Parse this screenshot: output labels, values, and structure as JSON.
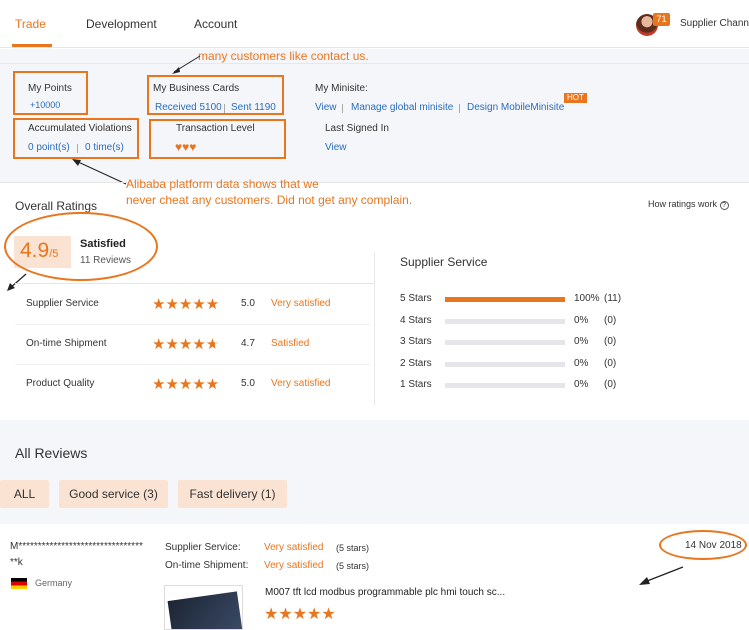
{
  "nav": {
    "tabs": [
      "Trade",
      "Development",
      "Account"
    ],
    "badge": "71",
    "channel": "Supplier Channe"
  },
  "annotations": {
    "contact": "many customers like contact us.",
    "cheat_line1": "Alibaba platform data shows that we",
    "cheat_line2": "never cheat any customers. Did not get any complain."
  },
  "account": {
    "points_label": "My Points",
    "points_value": "+10000",
    "cards_label": "My Business Cards",
    "cards_received": "Received 5100",
    "cards_sent": "Sent 1190",
    "minisite_label": "My Minisite:",
    "minisite_links": [
      "View",
      "Manage global minisite",
      "Design MobileMinisite"
    ],
    "hot_badge": "HOT",
    "violations_label": "Accumulated Violations",
    "violations_points": "0 point(s)",
    "violations_times": "0 time(s)",
    "transaction_label": "Transaction Level",
    "transaction_level": 3,
    "last_signed_label": "Last Signed In",
    "last_signed_link": "View"
  },
  "ratings": {
    "title": "Overall Ratings",
    "how_link": "How ratings work",
    "score": "4.9",
    "score_max": "/5",
    "summary": "Satisfied",
    "reviews": "11 Reviews",
    "categories": [
      {
        "name": "Supplier Service",
        "stars": 5.0,
        "score": "5.0",
        "verdict": "Very satisfied"
      },
      {
        "name": "On-time Shipment",
        "stars": 4.7,
        "score": "4.7",
        "verdict": "Satisfied"
      },
      {
        "name": "Product Quality",
        "stars": 5.0,
        "score": "5.0",
        "verdict": "Very satisfied"
      }
    ],
    "breakdown_title": "Supplier Service",
    "breakdown": [
      {
        "label": "5 Stars",
        "fraction": 1.0,
        "pct": "100%",
        "count": "(11)"
      },
      {
        "label": "4 Stars",
        "fraction": 0,
        "pct": "0%",
        "count": "(0)"
      },
      {
        "label": "3 Stars",
        "fraction": 0,
        "pct": "0%",
        "count": "(0)"
      },
      {
        "label": "2 Stars",
        "fraction": 0,
        "pct": "0%",
        "count": "(0)"
      },
      {
        "label": "1 Stars",
        "fraction": 0,
        "pct": "0%",
        "count": "(0)"
      }
    ]
  },
  "reviews": {
    "title": "All Reviews",
    "filters": [
      "ALL",
      "Good service (3)",
      "Fast delivery (1)"
    ],
    "item": {
      "buyer_line1": "M********************************",
      "buyer_line2": "**k",
      "country": "Germany",
      "service_label": "Supplier Service:",
      "service_verdict": "Very satisfied",
      "service_stars": "(5 stars)",
      "shipment_label": "On-time Shipment:",
      "shipment_verdict": "Very satisfied",
      "shipment_stars": "(5 stars)",
      "date": "14 Nov 2018",
      "product_title": "M007 tft lcd modbus programmable plc hmi touch sc...",
      "product_stars": 5
    }
  },
  "colors": {
    "accent": "#e8761f",
    "link": "#2a6ebb",
    "bar_bg": "#e6e6ea"
  }
}
